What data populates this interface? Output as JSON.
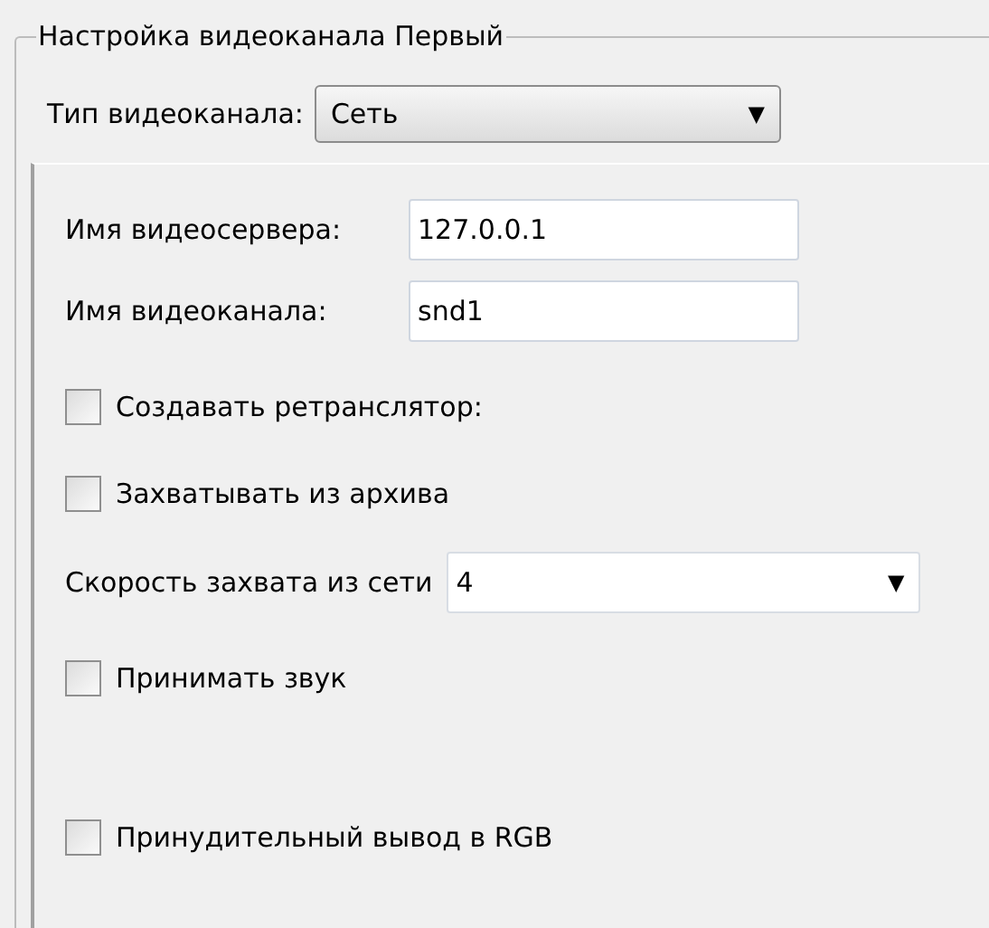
{
  "group": {
    "title": "Настройка видеоканала Первый"
  },
  "channel_type": {
    "label": "Тип видеоканала:",
    "value": "Сеть",
    "arrow": "▼"
  },
  "settings": [
    {
      "kind": "field",
      "label": "Имя видеосервера:",
      "value": "127.0.0.1"
    },
    {
      "kind": "field",
      "label": "Имя видеоканала:",
      "value": "snd1"
    },
    {
      "kind": "checkbox",
      "label": "Создавать ретранслятор:",
      "checked": false
    },
    {
      "kind": "checkbox",
      "label": "Захватывать из архива",
      "checked": false
    },
    {
      "kind": "dropdown",
      "label": "Скорость захвата из сети",
      "value": "4",
      "arrow": "▼"
    },
    {
      "kind": "checkbox",
      "label": "Принимать звук",
      "checked": false
    },
    {
      "kind": "checkbox",
      "label": "Принудительный вывод в RGB",
      "checked": false
    }
  ]
}
